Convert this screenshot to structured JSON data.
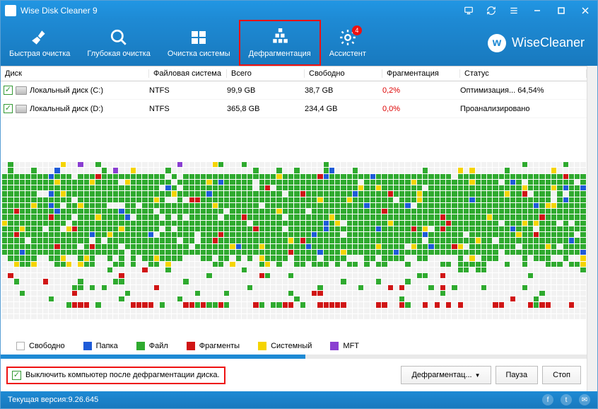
{
  "app": {
    "title": "Wise Disk Cleaner 9"
  },
  "brand": {
    "name": "WiseCleaner"
  },
  "tabs": {
    "quick": {
      "label": "Быстрая очистка"
    },
    "deep": {
      "label": "Глубокая очистка"
    },
    "system": {
      "label": "Очистка системы"
    },
    "defrag": {
      "label": "Дефрагментация"
    },
    "assist": {
      "label": "Ассистент",
      "badge": "4"
    }
  },
  "columns": {
    "disk": "Диск",
    "fs": "Файловая система",
    "total": "Всего",
    "free": "Свободно",
    "frag": "Фрагментация",
    "status": "Статус"
  },
  "disks": [
    {
      "name": "Локальный диск (C:)",
      "fs": "NTFS",
      "total": "99,9 GB",
      "free": "38,7 GB",
      "frag": "0,2%",
      "status": "Оптимизация... 64,54%"
    },
    {
      "name": "Локальный диск (D:)",
      "fs": "NTFS",
      "total": "365,8 GB",
      "free": "234,4 GB",
      "frag": "0,0%",
      "status": "Проанализировано"
    }
  ],
  "legend": {
    "free": "Свободно",
    "folder": "Папка",
    "file": "Файл",
    "frag": "Фрагменты",
    "system": "Системный",
    "mft": "MFT"
  },
  "colors": {
    "free": "#ffffff",
    "free_border": "#b0b0b0",
    "folder": "#1e5bd8",
    "file": "#2faa2f",
    "frag": "#d01515",
    "system": "#f5d400",
    "mft": "#8a3fd1",
    "empty": "#e8e8e8"
  },
  "controls": {
    "shutdown": "Выключить компьютер после дефрагментации диска.",
    "defrag_btn": "Дефрагментац...",
    "pause": "Пауза",
    "stop": "Стоп"
  },
  "status": {
    "version_label": "Текущая версия:",
    "version": "9.26.645"
  },
  "progress_pct": 52
}
